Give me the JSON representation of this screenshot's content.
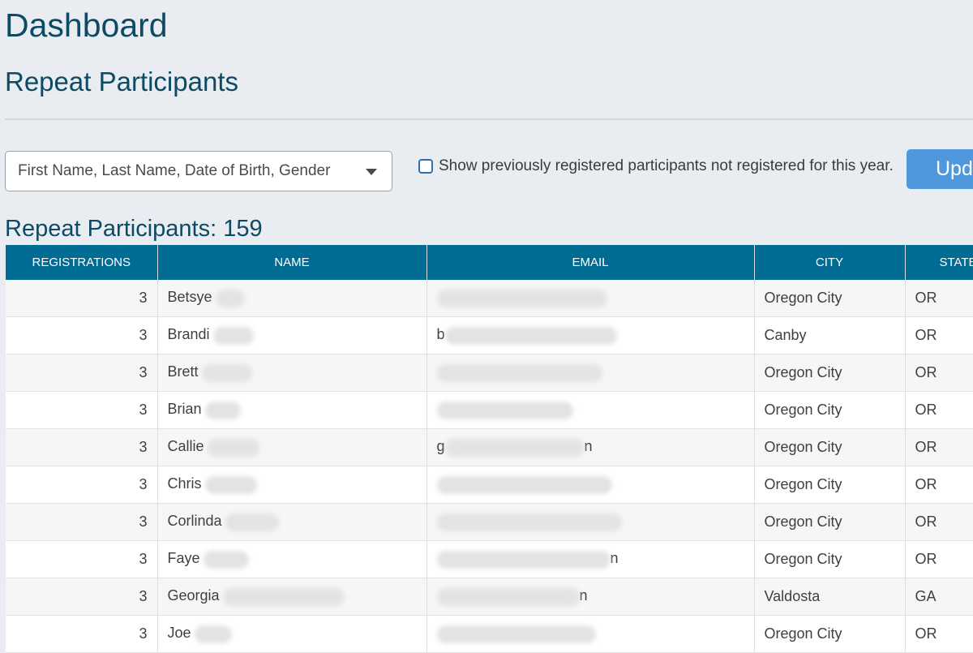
{
  "header": {
    "title": "Dashboard",
    "section_title": "Repeat Participants"
  },
  "filters": {
    "match_select_value": "First Name, Last Name, Date of Birth, Gender",
    "show_previous_label": "Show previously registered participants not registered for this year.",
    "update_label": "Upd"
  },
  "summary": {
    "count_label": "Repeat Participants: 159"
  },
  "table": {
    "columns": [
      "REGISTRATIONS",
      "NAME",
      "EMAIL",
      "CITY",
      "STATE"
    ],
    "rows": [
      {
        "registrations": "3",
        "name": "Betsye",
        "email_prefix": "",
        "email_suffix": "",
        "city": "Oregon City",
        "state": "OR"
      },
      {
        "registrations": "3",
        "name": "Brandi",
        "email_prefix": "b",
        "email_suffix": "",
        "city": "Canby",
        "state": "OR"
      },
      {
        "registrations": "3",
        "name": "Brett",
        "email_prefix": "",
        "email_suffix": "",
        "city": "Oregon City",
        "state": "OR"
      },
      {
        "registrations": "3",
        "name": "Brian",
        "email_prefix": "",
        "email_suffix": "",
        "city": "Oregon City",
        "state": "OR"
      },
      {
        "registrations": "3",
        "name": "Callie",
        "email_prefix": "g",
        "email_suffix": "n",
        "city": "Oregon City",
        "state": "OR"
      },
      {
        "registrations": "3",
        "name": "Chris",
        "email_prefix": "",
        "email_suffix": "",
        "city": "Oregon City",
        "state": "OR"
      },
      {
        "registrations": "3",
        "name": "Corlinda",
        "email_prefix": "",
        "email_suffix": "",
        "city": "Oregon City",
        "state": "OR"
      },
      {
        "registrations": "3",
        "name": "Faye",
        "email_prefix": "",
        "email_suffix": "n",
        "city": "Oregon City",
        "state": "OR"
      },
      {
        "registrations": "3",
        "name": "Georgia",
        "email_prefix": "",
        "email_suffix": "n",
        "city": "Valdosta",
        "state": "GA"
      },
      {
        "registrations": "3",
        "name": "Joe",
        "email_prefix": "",
        "email_suffix": "",
        "city": "Oregon City",
        "state": "OR"
      }
    ]
  },
  "colors": {
    "header_bg": "#006c93",
    "title_text": "#0d4a63",
    "button_bg": "#4f98dc"
  }
}
